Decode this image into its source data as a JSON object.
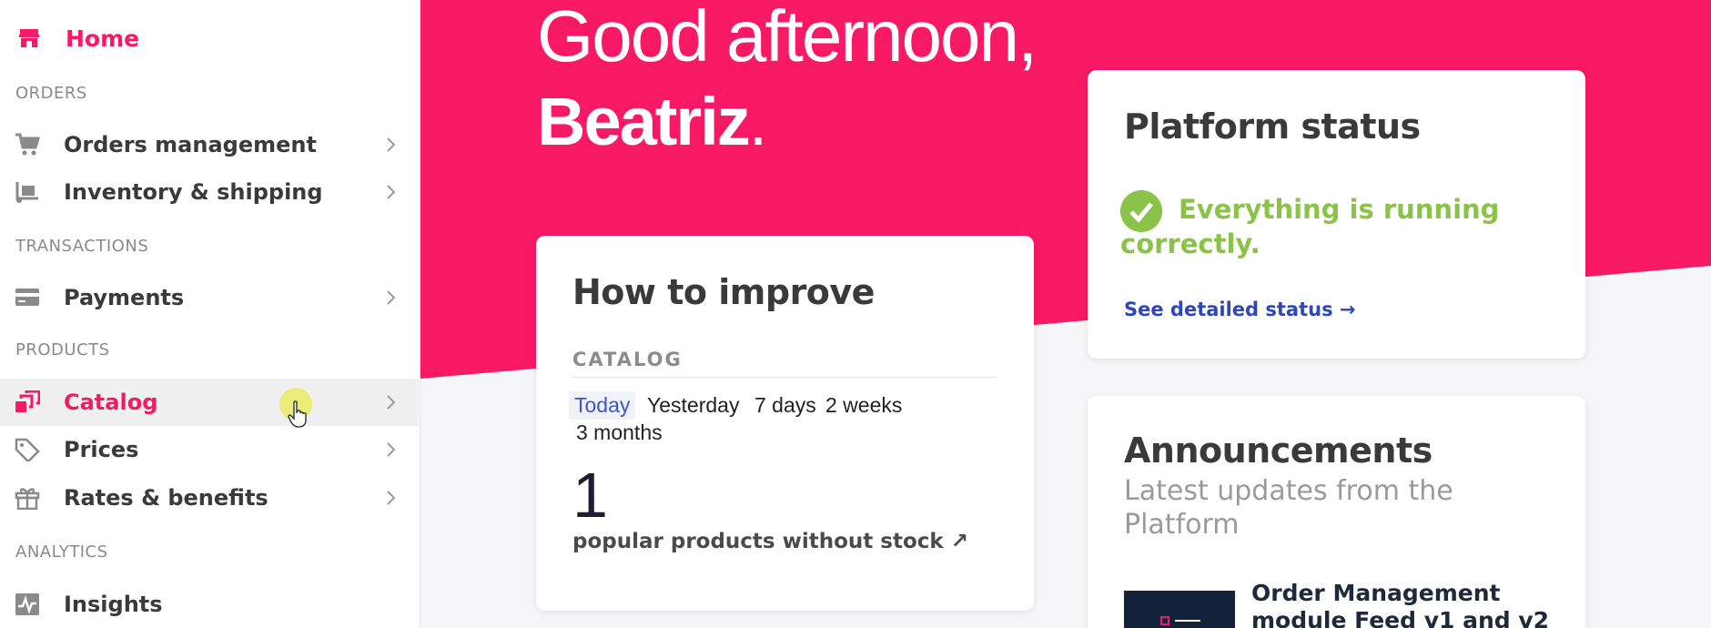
{
  "sidebar": {
    "home": {
      "label": "Home",
      "icon": "store-icon"
    },
    "sections": {
      "orders": "ORDERS",
      "transactions": "TRANSACTIONS",
      "products": "PRODUCTS",
      "analytics": "ANALYTICS"
    },
    "items": [
      {
        "label": "Orders management",
        "icon": "cart-icon",
        "active": false
      },
      {
        "label": "Inventory & shipping",
        "icon": "dolly-icon",
        "active": false
      },
      {
        "label": "Payments",
        "icon": "credit-card-icon",
        "active": false
      },
      {
        "label": "Catalog",
        "icon": "catalog-icon",
        "active": true
      },
      {
        "label": "Prices",
        "icon": "tag-icon",
        "active": false
      },
      {
        "label": "Rates & benefits",
        "icon": "gift-icon",
        "active": false
      },
      {
        "label": "Insights",
        "icon": "chart-pulse-icon",
        "active": false
      }
    ]
  },
  "greeting": {
    "line1": "Good afternoon,",
    "name": "Beatriz",
    "punct": "."
  },
  "improve": {
    "title": "How to improve",
    "section": "CATALOG",
    "ranges": [
      "Today",
      "Yesterday",
      "7 days",
      "2 weeks",
      "3 months"
    ],
    "selected_range": "Today",
    "count": "1",
    "count_label": "popular products without stock ↗"
  },
  "status": {
    "title": "Platform status",
    "message": "Everything is running correctly.",
    "link": "See detailed status →"
  },
  "announcements": {
    "title": "Announcements",
    "subtitle": "Latest updates from the Platform",
    "first_item_title": "Order Management module Feed v1 and v2"
  },
  "colors": {
    "brand": "#f71963",
    "success": "#8bc34a",
    "link": "#2e46b8"
  }
}
